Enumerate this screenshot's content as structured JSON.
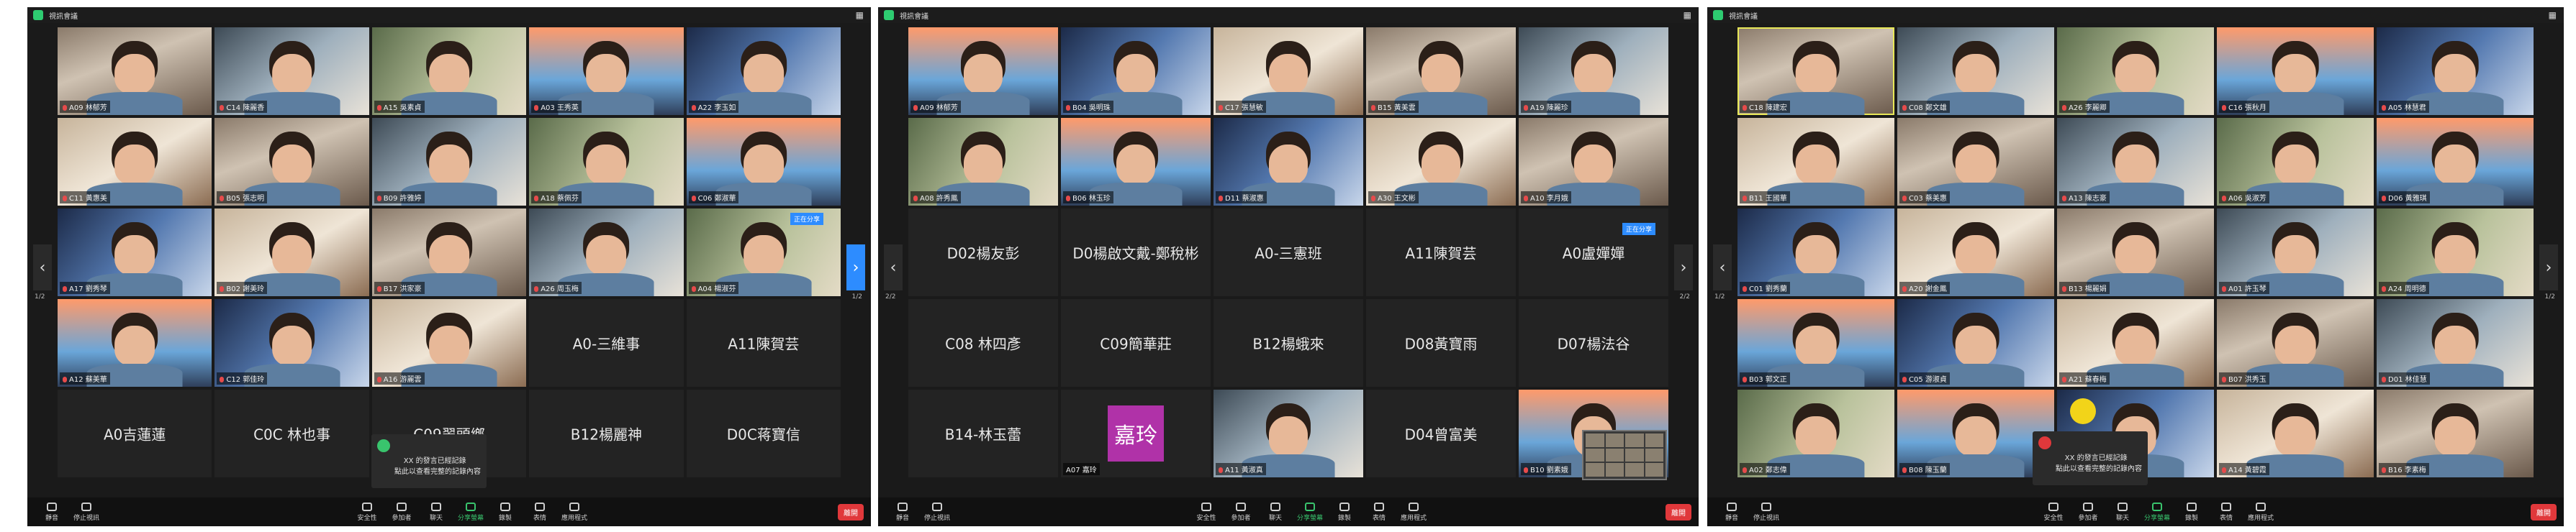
{
  "windows": [
    {
      "title": "視訊會議",
      "page_left": "1/2",
      "page_right": "1/2",
      "tiles": [
        {
          "type": "video",
          "name": "A09 林郁芳"
        },
        {
          "type": "video",
          "name": "C14 陳麗香"
        },
        {
          "type": "video",
          "name": "A15 吳素貞"
        },
        {
          "type": "video",
          "name": "A03 王秀英"
        },
        {
          "type": "video",
          "name": "A22 李玉如"
        },
        {
          "type": "video",
          "name": "C11 黃惠美"
        },
        {
          "type": "video",
          "name": "B05 張志明"
        },
        {
          "type": "video",
          "name": "B09 許雅婷"
        },
        {
          "type": "video",
          "name": "A18 蔡佩芬"
        },
        {
          "type": "video",
          "name": "C06 鄭淑華"
        },
        {
          "type": "video",
          "name": "A17 劉秀琴"
        },
        {
          "type": "video",
          "name": "B02 謝美玲"
        },
        {
          "type": "video",
          "name": "B17 洪家豪"
        },
        {
          "type": "video",
          "name": "A26 周玉梅"
        },
        {
          "type": "video",
          "name": "A04 楊淑芬"
        },
        {
          "type": "video",
          "name": "A12 蘇美華"
        },
        {
          "type": "video",
          "name": "C12 郭佳玲"
        },
        {
          "type": "video",
          "name": "A16 游麗雲"
        },
        {
          "type": "name",
          "name": "A0-三維事"
        },
        {
          "type": "name",
          "name": "A11陳賀芸"
        },
        {
          "type": "name",
          "name": "A0吉蓮蓮"
        },
        {
          "type": "name",
          "name": "C0C 林也事"
        },
        {
          "type": "name",
          "name": "C09翠頭鄉"
        },
        {
          "type": "name",
          "name": "B12楊麗神"
        },
        {
          "type": "name",
          "name": "D0C蒋寶信"
        }
      ],
      "chat": "XX 的發言已經記錄\n點此以查看完整的記錄內容",
      "share_label": "正在分享",
      "toolbar": {
        "mute": "靜音",
        "video": "停止視訊",
        "security": "安全性",
        "participants": "參加者",
        "chat": "聊天",
        "share": "分享螢幕",
        "record": "錄製",
        "reactions": "表情",
        "apps": "應用程式",
        "end": "離開"
      }
    },
    {
      "title": "視訊會議",
      "page_left": "2/2",
      "page_right": "2/2",
      "tiles": [
        {
          "type": "video",
          "name": "A09 林郁芳"
        },
        {
          "type": "video",
          "name": "B04 吳明珠"
        },
        {
          "type": "video",
          "name": "C17 張慧敏"
        },
        {
          "type": "video",
          "name": "B15 黃美雲"
        },
        {
          "type": "video",
          "name": "A19 陳麗珍"
        },
        {
          "type": "video",
          "name": "A08 許秀鳳"
        },
        {
          "type": "video",
          "name": "B06 林玉珍"
        },
        {
          "type": "video",
          "name": "D11 蔡淑惠"
        },
        {
          "type": "video",
          "name": "A30 王文彬"
        },
        {
          "type": "video",
          "name": "A10 李月娥"
        },
        {
          "type": "name",
          "name": "D02楊友彭"
        },
        {
          "type": "name",
          "name": "D0楊啟文戴-鄭稅彬"
        },
        {
          "type": "name",
          "name": "A0-三憲班"
        },
        {
          "type": "name",
          "name": "A11陳賀芸"
        },
        {
          "type": "name",
          "name": "A0盧嬋嬋"
        },
        {
          "type": "name",
          "name": "C08 林四彥"
        },
        {
          "type": "name",
          "name": "C09簡華莊"
        },
        {
          "type": "name",
          "name": "B12楊蛾來"
        },
        {
          "type": "name",
          "name": "D08黃寶雨"
        },
        {
          "type": "name",
          "name": "D07楊法谷"
        },
        {
          "type": "name",
          "name": "B14-林玉蕾"
        },
        {
          "type": "avatar",
          "name": "A07 嘉玲",
          "avatar": "嘉玲"
        },
        {
          "type": "video",
          "name": "A11 黃淑真"
        },
        {
          "type": "name",
          "name": "D04曾富美"
        },
        {
          "type": "video",
          "name": "B10 劉素娥"
        }
      ],
      "share_label": "正在分享",
      "toolbar": {
        "mute": "靜音",
        "video": "停止視訊",
        "security": "安全性",
        "participants": "參加者",
        "chat": "聊天",
        "share": "分享螢幕",
        "record": "錄製",
        "reactions": "表情",
        "apps": "應用程式",
        "end": "離開"
      }
    },
    {
      "title": "視訊會議",
      "page_left": "1/2",
      "page_right": "1/2",
      "tiles": [
        {
          "type": "video",
          "name": "C18 陳建宏"
        },
        {
          "type": "video",
          "name": "C08 鄭文雄"
        },
        {
          "type": "video",
          "name": "A26 李麗卿"
        },
        {
          "type": "video",
          "name": "C16 張秋月"
        },
        {
          "type": "video",
          "name": "A05 林慧君"
        },
        {
          "type": "video",
          "name": "B11 王國華"
        },
        {
          "type": "video",
          "name": "C03 蔡美惠"
        },
        {
          "type": "video",
          "name": "A13 陳志豪"
        },
        {
          "type": "video",
          "name": "A06 吳淑芳"
        },
        {
          "type": "video",
          "name": "D06 黃雅琪"
        },
        {
          "type": "video",
          "name": "C01 劉秀蘭"
        },
        {
          "type": "video",
          "name": "A20 謝金鳳"
        },
        {
          "type": "video",
          "name": "B13 楊麗娟"
        },
        {
          "type": "video",
          "name": "A01 許玉琴"
        },
        {
          "type": "video",
          "name": "A24 周明德"
        },
        {
          "type": "video",
          "name": "B03 郭文正"
        },
        {
          "type": "video",
          "name": "C05 游淑貞"
        },
        {
          "type": "video",
          "name": "A21 蘇春梅"
        },
        {
          "type": "video",
          "name": "B07 洪秀玉"
        },
        {
          "type": "video",
          "name": "D01 林佳慧"
        },
        {
          "type": "video",
          "name": "A02 鄭志偉"
        },
        {
          "type": "video",
          "name": "B08 陳玉蘭"
        },
        {
          "type": "video",
          "name": "C10 張美珍"
        },
        {
          "type": "video",
          "name": "A14 黃碧霞"
        },
        {
          "type": "video",
          "name": "B16 李素梅"
        }
      ],
      "chat": "XX 的發言已經記錄\n點此以查看完整的記錄內容",
      "toolbar": {
        "mute": "靜音",
        "video": "停止視訊",
        "security": "安全性",
        "participants": "參加者",
        "chat": "聊天",
        "share": "分享螢幕",
        "record": "錄製",
        "reactions": "表情",
        "apps": "應用程式",
        "end": "離開"
      }
    }
  ],
  "colors": {
    "window_bg": "#1a1a1a",
    "tile_bg": "#232323",
    "accent": "#2d8cff",
    "end": "#e0383b",
    "share_green": "#39c46d",
    "avatar": "#b032a8"
  },
  "icons": [
    "shield-icon",
    "gallery-view-icon",
    "microphone-icon",
    "video-camera-icon",
    "security-icon",
    "participants-icon",
    "chat-icon",
    "share-screen-icon",
    "record-icon",
    "reactions-icon",
    "apps-icon",
    "chevron-left-icon",
    "chevron-right-icon"
  ]
}
